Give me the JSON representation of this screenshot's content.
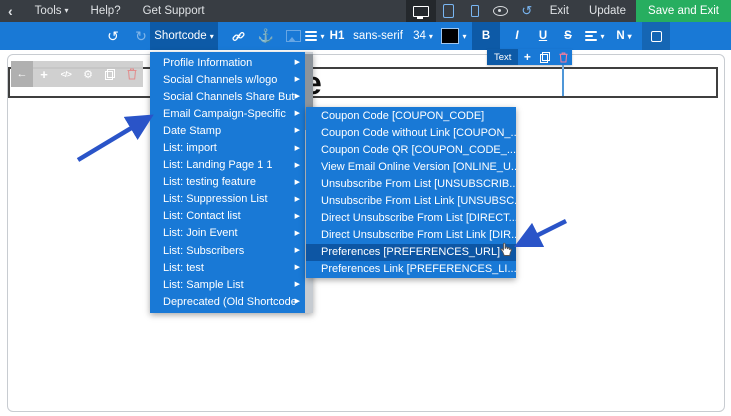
{
  "colors": {
    "topbar_bg": "#383d43",
    "toolbar_blue": "#1979d6",
    "active_button_blue": "#0d5aa7",
    "menu_highlight_blue": "#0d56a4",
    "save_button_green": "#27ae60",
    "annotation_arrow_blue": "#2a54c8",
    "selection_border": "#3f3f3f"
  },
  "icons": {
    "chevron_left": "‹",
    "caret_down": "▾",
    "undo": "↺",
    "redo": "↻",
    "anchor": "⚓",
    "back_arrow": "←",
    "move": "+",
    "code": "</>",
    "gear": "⚙",
    "history": "↺",
    "submenu_arrow": "▶"
  },
  "topbar": {
    "tools": "Tools",
    "help": "Help?",
    "get_support": "Get Support",
    "exit": "Exit",
    "update": "Update",
    "save_and_exit": "Save and Exit"
  },
  "toolbar": {
    "shortcode": "Shortcode",
    "heading_level": "H1",
    "font_family": "sans-serif",
    "font_size": "34",
    "bold": "B",
    "italic": "I",
    "underline": "U",
    "strikethrough": "S",
    "direction": "N"
  },
  "float_toolbar": {
    "label": "Text"
  },
  "canvas": {
    "heading_visible_text": "e"
  },
  "menu": {
    "items": [
      "Profile Information",
      "Social Channels w/logo",
      "Social Channels Share Buttons",
      "Email Campaign-Specific",
      "Date Stamp",
      "List: import",
      "List: Landing Page 1 1",
      "List: testing feature",
      "List: Suppression List",
      "List: Contact list",
      "List: Join Event",
      "List: Subscribers",
      "List: test",
      "List: Sample List",
      "Deprecated (Old Shortcodes)"
    ]
  },
  "submenu": {
    "items": [
      "Coupon Code [COUPON_CODE]",
      "Coupon Code without Link [COUPON_...",
      "Coupon Code QR [COUPON_CODE_...",
      "View Email Online Version [ONLINE_U...",
      "Unsubscribe From List [UNSUBSCRIB...",
      "Unsubscribe From List Link [UNSUBSC...",
      "Direct Unsubscribe From List [DIRECT...",
      "Direct Unsubscribe From List Link [DIR...",
      "Preferences [PREFERENCES_URL]",
      "Preferences Link [PREFERENCES_LI..."
    ],
    "highlighted": "Preferences [PREFERENCES_URL]"
  }
}
